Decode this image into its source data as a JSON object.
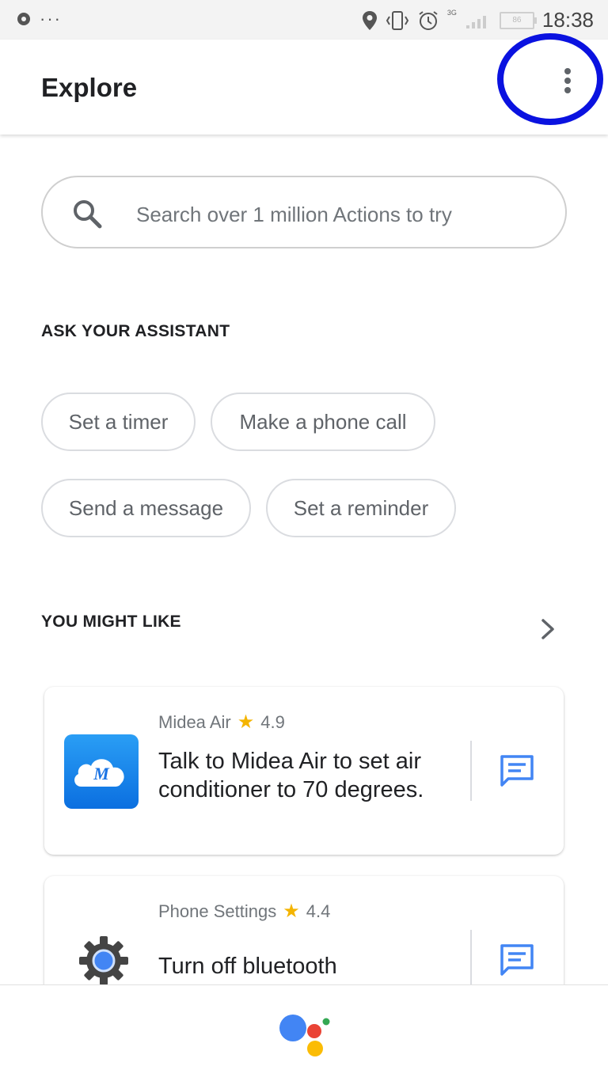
{
  "status_bar": {
    "dots": "···",
    "network": "3G",
    "battery": "86",
    "time": "18:38"
  },
  "header": {
    "title": "Explore"
  },
  "search": {
    "placeholder": "Search over 1 million Actions to try"
  },
  "ask_assistant": {
    "heading": "ASK YOUR ASSISTANT",
    "chips": [
      "Set a timer",
      "Make a phone call",
      "Send a message",
      "Set a reminder"
    ]
  },
  "you_might_like": {
    "heading": "YOU MIGHT LIKE",
    "cards": [
      {
        "app_name": "Midea Air",
        "rating": "4.9",
        "text_line1": "Talk to Midea Air to set air",
        "text_line2": "conditioner to 70 degrees.",
        "icon": "midea-cloud-icon"
      },
      {
        "app_name": "Phone Settings",
        "rating": "4.4",
        "text_line1": "Turn off bluetooth",
        "text_line2": "",
        "icon": "gear-icon"
      }
    ]
  },
  "colors": {
    "highlight": "#0a12e0",
    "chat_icon": "#4285f4",
    "star": "#f4b400",
    "logo_blue": "#4285f4",
    "logo_red": "#ea4335",
    "logo_yellow": "#fbbc05",
    "logo_green": "#34a853"
  }
}
